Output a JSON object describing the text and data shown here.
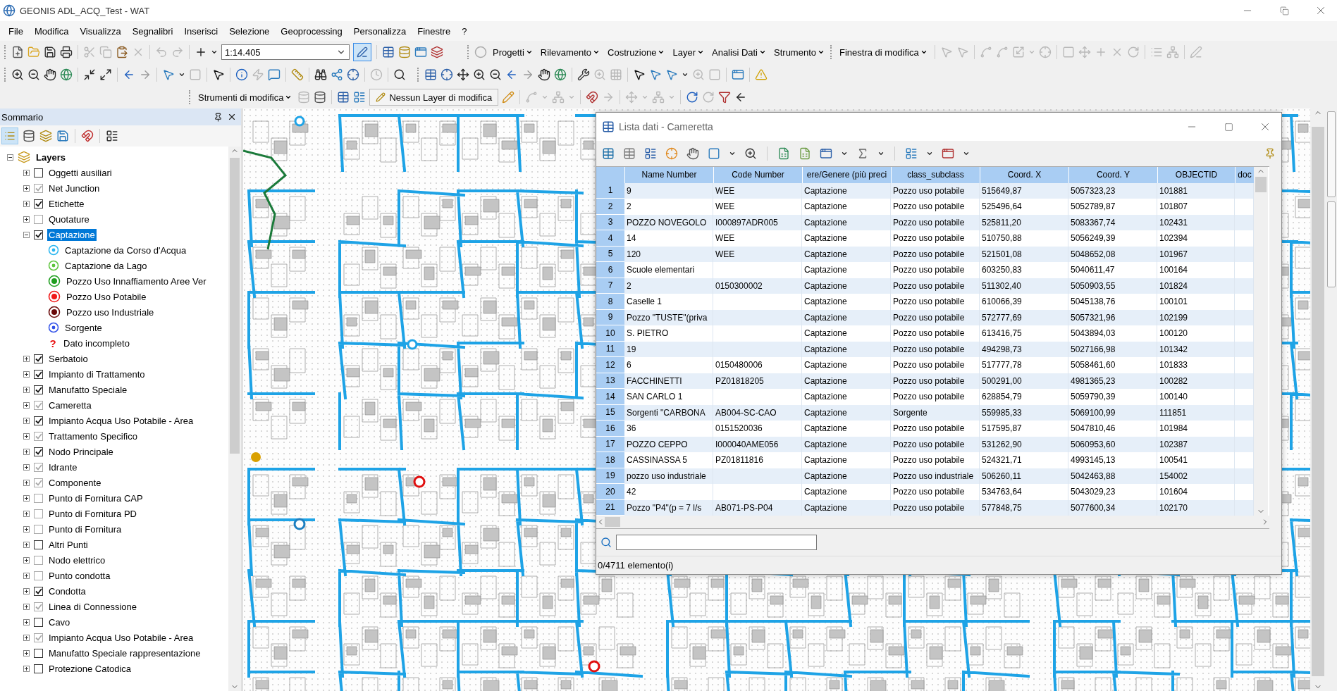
{
  "window": {
    "title": "GEONIS  ADL_ACQ_Test - WAT"
  },
  "menu": [
    "File",
    "Modifica",
    "Visualizza",
    "Segnalibri",
    "Inserisci",
    "Selezione",
    "Geoprocessing",
    "Personalizza",
    "Finestre",
    "?"
  ],
  "toolbar": {
    "scale": "1:14.405",
    "dropdowns": [
      "Progetti",
      "Rilevamento",
      "Costruzione",
      "Layer",
      "Analisi Dati",
      "Strumento"
    ],
    "edit_window": "Finestra di modifica",
    "edit_tools": "Strumenti di modifica",
    "edit_layer": "Nessun Layer di modifica"
  },
  "sidebar": {
    "title": "Sommario",
    "root": {
      "label": "Layers",
      "expanded": true,
      "children": [
        {
          "label": "Oggetti ausiliari",
          "checked": false,
          "dimmed": false,
          "expanded": false,
          "selected": false
        },
        {
          "label": "Net Junction",
          "checked": true,
          "dimmed": true,
          "expanded": false,
          "selected": false
        },
        {
          "label": "Etichette",
          "checked": true,
          "dimmed": false,
          "expanded": false,
          "selected": false
        },
        {
          "label": "Quotature",
          "checked": false,
          "dimmed": true,
          "expanded": false,
          "selected": false
        },
        {
          "label": "Captazione",
          "checked": true,
          "dimmed": false,
          "expanded": true,
          "selected": true,
          "children": [
            {
              "label": "Captazione da Corso d'Acqua",
              "kind": "dot",
              "color": "#2bb6f0"
            },
            {
              "label": "Captazione da Lago",
              "kind": "dot",
              "color": "#5cc43a"
            },
            {
              "label": "Pozzo Uso Innaffiamento Aree Ver",
              "kind": "ring",
              "color": "#1f9e1f"
            },
            {
              "label": "Pozzo Uso Potabile",
              "kind": "ring",
              "color": "#f01818"
            },
            {
              "label": "Pozzo uso Industriale",
              "kind": "ring",
              "color": "#6a0a0a"
            },
            {
              "label": "Sorgente",
              "kind": "dot",
              "color": "#3050e8"
            },
            {
              "label": "Dato incompleto",
              "kind": "question",
              "symbol": "?",
              "color": "#e81010"
            }
          ]
        },
        {
          "label": "Serbatoio",
          "checked": true,
          "dimmed": false,
          "expanded": false,
          "selected": false
        },
        {
          "label": "Impianto di Trattamento",
          "checked": true,
          "dimmed": false,
          "expanded": false,
          "selected": false
        },
        {
          "label": "Manufatto Speciale",
          "checked": true,
          "dimmed": false,
          "expanded": false,
          "selected": false
        },
        {
          "label": "Cameretta",
          "checked": true,
          "dimmed": true,
          "expanded": false,
          "selected": false
        },
        {
          "label": "Impianto Acqua Uso Potabile - Area",
          "checked": true,
          "dimmed": false,
          "expanded": false,
          "selected": false
        },
        {
          "label": "Trattamento Specifico",
          "checked": true,
          "dimmed": true,
          "expanded": false,
          "selected": false
        },
        {
          "label": "Nodo Principale",
          "checked": true,
          "dimmed": false,
          "expanded": false,
          "selected": false
        },
        {
          "label": "Idrante",
          "checked": true,
          "dimmed": true,
          "expanded": false,
          "selected": false
        },
        {
          "label": "Componente",
          "checked": true,
          "dimmed": true,
          "expanded": false,
          "selected": false
        },
        {
          "label": "Punto di Fornitura CAP",
          "checked": false,
          "dimmed": true,
          "expanded": false,
          "selected": false
        },
        {
          "label": "Punto di Fornitura PD",
          "checked": false,
          "dimmed": true,
          "expanded": false,
          "selected": false
        },
        {
          "label": "Punto di Fornitura",
          "checked": false,
          "dimmed": true,
          "expanded": false,
          "selected": false
        },
        {
          "label": "Altri Punti",
          "checked": false,
          "dimmed": false,
          "expanded": false,
          "selected": false
        },
        {
          "label": "Nodo elettrico",
          "checked": false,
          "dimmed": true,
          "expanded": false,
          "selected": false
        },
        {
          "label": "Punto condotta",
          "checked": false,
          "dimmed": true,
          "expanded": false,
          "selected": false
        },
        {
          "label": "Condotta",
          "checked": true,
          "dimmed": false,
          "expanded": false,
          "selected": false
        },
        {
          "label": "Linea di Connessione",
          "checked": true,
          "dimmed": true,
          "expanded": false,
          "selected": false
        },
        {
          "label": "Cavo",
          "checked": false,
          "dimmed": false,
          "expanded": false,
          "selected": false
        },
        {
          "label": "Impianto Acqua Uso Potabile - Area",
          "checked": true,
          "dimmed": true,
          "expanded": false,
          "selected": false
        },
        {
          "label": "Manufatto Speciale rappresentazione",
          "checked": false,
          "dimmed": false,
          "expanded": false,
          "selected": false
        },
        {
          "label": "Protezione Catodica",
          "checked": false,
          "dimmed": false,
          "expanded": false,
          "selected": false
        }
      ]
    }
  },
  "table_window": {
    "title": "Lista dati - Cameretta",
    "columns": [
      "Name Number",
      "Code Number",
      "ere/Genere (più preci",
      "class_subclass",
      "Coord. X",
      "Coord. Y",
      "OBJECTID",
      "doc"
    ],
    "rows": [
      {
        "number": "1",
        "cells": [
          "9",
          "WEE",
          "Captazione",
          "Pozzo uso potabile",
          "515649,87",
          "5057323,23",
          "101881",
          ""
        ]
      },
      {
        "number": "2",
        "cells": [
          "2",
          "WEE",
          "Captazione",
          "Pozzo uso potabile",
          "525496,64",
          "5052789,87",
          "101807",
          ""
        ]
      },
      {
        "number": "3",
        "cells": [
          "POZZO NOVEGOLO",
          "I000897ADR005",
          "Captazione",
          "Pozzo uso potabile",
          "525811,20",
          "5083367,74",
          "102431",
          ""
        ]
      },
      {
        "number": "4",
        "cells": [
          "14",
          "WEE",
          "Captazione",
          "Pozzo uso potabile",
          "510750,88",
          "5056249,39",
          "102394",
          ""
        ]
      },
      {
        "number": "5",
        "cells": [
          "120",
          "WEE",
          "Captazione",
          "Pozzo uso potabile",
          "521501,08",
          "5048652,08",
          "101967",
          ""
        ]
      },
      {
        "number": "6",
        "cells": [
          "Scuole elementari",
          "",
          "Captazione",
          "Pozzo uso potabile",
          "603250,83",
          "5040611,47",
          "100164",
          ""
        ]
      },
      {
        "number": "7",
        "cells": [
          "2",
          "0150300002",
          "Captazione",
          "Pozzo uso potabile",
          "511302,40",
          "5050903,55",
          "101824",
          ""
        ]
      },
      {
        "number": "8",
        "cells": [
          "Caselle 1",
          "",
          "Captazione",
          "Pozzo uso potabile",
          "610066,39",
          "5045138,76",
          "100101",
          ""
        ]
      },
      {
        "number": "9",
        "cells": [
          "Pozzo \"TUSTE\"(priva",
          "",
          "Captazione",
          "Pozzo uso potabile",
          "572777,69",
          "5057321,96",
          "102199",
          ""
        ]
      },
      {
        "number": "10",
        "cells": [
          "S. PIETRO",
          "",
          "Captazione",
          "Pozzo uso potabile",
          "613416,75",
          "5043894,03",
          "100120",
          ""
        ]
      },
      {
        "number": "11",
        "cells": [
          "19",
          "",
          "Captazione",
          "Pozzo uso potabile",
          "494298,73",
          "5027166,98",
          "101342",
          ""
        ]
      },
      {
        "number": "12",
        "cells": [
          "6",
          "0150480006",
          "Captazione",
          "Pozzo uso potabile",
          "517777,78",
          "5058461,60",
          "101833",
          ""
        ]
      },
      {
        "number": "13",
        "cells": [
          "FACCHINETTI",
          "PZ01818205",
          "Captazione",
          "Pozzo uso potabile",
          "500291,00",
          "4981365,23",
          "100282",
          ""
        ]
      },
      {
        "number": "14",
        "cells": [
          "SAN CARLO 1",
          "",
          "Captazione",
          "Pozzo uso potabile",
          "628854,79",
          "5059790,39",
          "100140",
          ""
        ]
      },
      {
        "number": "15",
        "cells": [
          "Sorgenti \"CARBONA",
          "AB004-SC-CAO",
          "Captazione",
          "Sorgente",
          "559985,33",
          "5069100,99",
          "111851",
          ""
        ]
      },
      {
        "number": "16",
        "cells": [
          "36",
          "0151520036",
          "Captazione",
          "Pozzo uso potabile",
          "517595,87",
          "5047810,46",
          "101984",
          ""
        ]
      },
      {
        "number": "17",
        "cells": [
          "POZZO CEPPO",
          "I000040AME056",
          "Captazione",
          "Pozzo uso potabile",
          "531262,90",
          "5060953,60",
          "102387",
          ""
        ]
      },
      {
        "number": "18",
        "cells": [
          "CASSINASSA 5",
          "PZ01811816",
          "Captazione",
          "Pozzo uso potabile",
          "524321,71",
          "4993145,13",
          "100541",
          ""
        ]
      },
      {
        "number": "19",
        "cells": [
          "pozzo uso industriale",
          "",
          "Captazione",
          "Pozzo uso industriale",
          "506260,11",
          "5042463,88",
          "154002",
          ""
        ]
      },
      {
        "number": "20",
        "cells": [
          "42",
          "",
          "Captazione",
          "Pozzo uso potabile",
          "534763,64",
          "5043029,23",
          "101604",
          ""
        ]
      },
      {
        "number": "21",
        "cells": [
          "Pozzo \"P4\"(p = 7 l/s",
          "AB071-PS-P04",
          "Captazione",
          "Pozzo uso potabile",
          "577848,75",
          "5077600,34",
          "102170",
          ""
        ]
      }
    ],
    "status": "0/4711 elemento(i)"
  }
}
